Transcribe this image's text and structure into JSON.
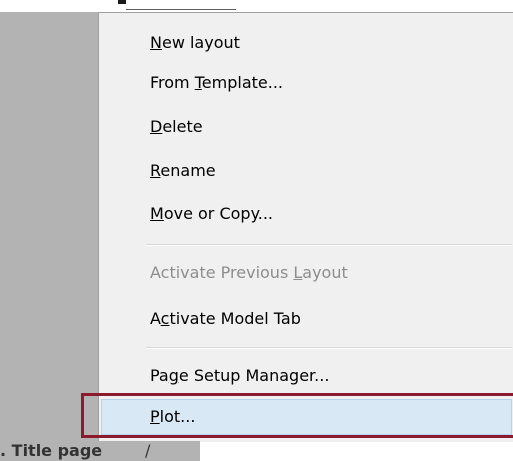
{
  "menu": {
    "items": [
      {
        "pre": "",
        "mn": "N",
        "post": "ew layout",
        "disabled": false
      },
      {
        "pre": "From ",
        "mn": "T",
        "post": "emplate...",
        "disabled": false
      },
      {
        "pre": "",
        "mn": "D",
        "post": "elete",
        "disabled": false
      },
      {
        "pre": "",
        "mn": "R",
        "post": "ename",
        "disabled": false
      },
      {
        "pre": "",
        "mn": "M",
        "post": "ove or Copy...",
        "disabled": false
      },
      {
        "pre": "Activate Previous ",
        "mn": "L",
        "post": "ayout",
        "disabled": true
      },
      {
        "pre": "A",
        "mn": "c",
        "post": "tivate Model Tab",
        "disabled": false
      },
      {
        "pre": "Pa",
        "mn": "g",
        "post": "e Setup Manager...",
        "disabled": false
      },
      {
        "pre": "",
        "mn": "P",
        "post": "lot...",
        "disabled": false
      }
    ]
  },
  "tab": {
    "label": ". Title page",
    "slash": "/"
  },
  "colors": {
    "menu_bg": "#f0f0f0",
    "disabled_text": "#8d8d8d",
    "highlight": "#d9e8f5",
    "callout": "#8b1a2e",
    "gray_area": "#b3b3b3"
  }
}
